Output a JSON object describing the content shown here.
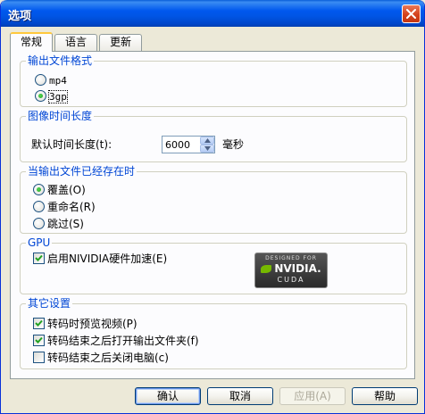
{
  "window": {
    "title": "选项"
  },
  "tabs": [
    {
      "label": "常规"
    },
    {
      "label": "语言"
    },
    {
      "label": "更新"
    }
  ],
  "output_format": {
    "title": "输出文件格式",
    "options": [
      {
        "label": "mp4",
        "checked": false
      },
      {
        "label": "3gp",
        "checked": true
      }
    ]
  },
  "duration": {
    "title": "图像时间长度",
    "label": "默认时间长度(t):",
    "value": "6000",
    "unit": "毫秒"
  },
  "file_exists": {
    "title": "当输出文件已经存在时",
    "options": [
      {
        "label": "覆盖(O)",
        "checked": true
      },
      {
        "label": "重命名(R)",
        "checked": false
      },
      {
        "label": "跳过(S)",
        "checked": false
      }
    ]
  },
  "gpu": {
    "title": "GPU",
    "checkbox_label": "启用NIVIDIA硬件加速(E)",
    "checked": true,
    "badge": {
      "top": "DESIGNED FOR",
      "brand": "NVIDIA.",
      "product": "CUDA"
    }
  },
  "other": {
    "title": "其它设置",
    "options": [
      {
        "label": "转码时预览视频(P)",
        "checked": true
      },
      {
        "label": "转码结束之后打开输出文件夹(f)",
        "checked": true
      },
      {
        "label": "转码结束之后关闭电脑(c)",
        "checked": false
      }
    ]
  },
  "buttons": {
    "ok": "确认",
    "cancel": "取消",
    "apply": "应用(A)",
    "help": "帮助"
  },
  "colors": {
    "title_bar": "#0058ee",
    "group_title": "#0046d5",
    "panel_bg": "#fcfcfe",
    "window_bg": "#ece9d8"
  }
}
